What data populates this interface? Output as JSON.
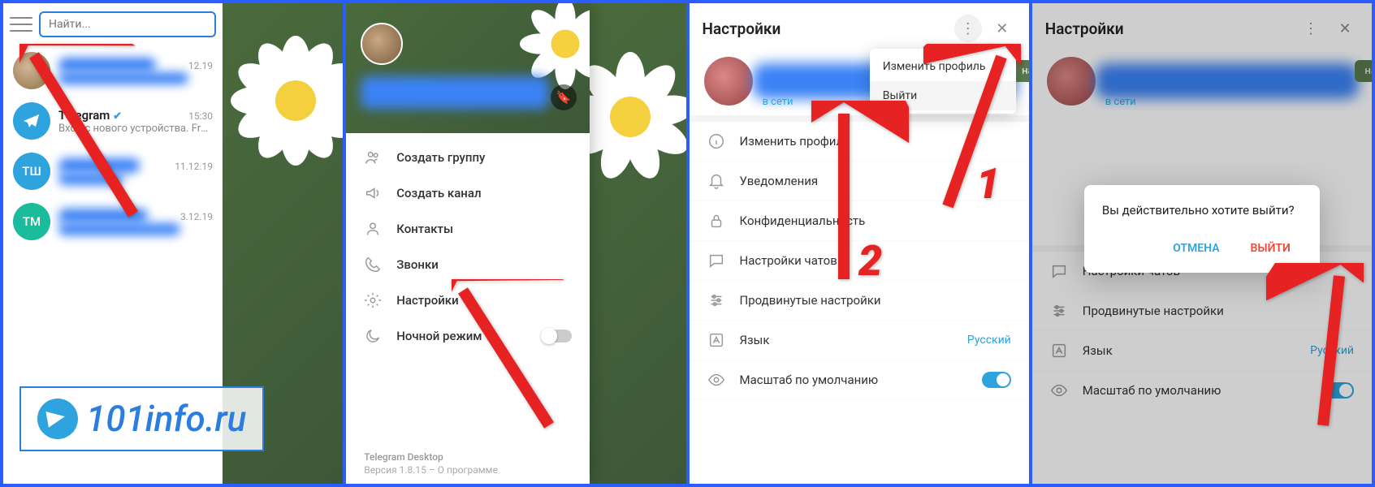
{
  "panel1": {
    "search_placeholder": "Найти...",
    "chats": [
      {
        "name": "",
        "date": "12.19",
        "preview": ""
      },
      {
        "name": "Telegram",
        "date": "15:30",
        "preview": "Вход с нового устройства. From...",
        "verified": true
      },
      {
        "initials": "ТШ",
        "name": "",
        "date": "11.12.19",
        "preview": ""
      },
      {
        "initials": "ТМ",
        "name": "",
        "date": "3.12.19",
        "preview": ""
      }
    ]
  },
  "watermark": "101info.ru",
  "drawer": {
    "items": [
      {
        "icon": "group",
        "label": "Создать группу"
      },
      {
        "icon": "channel",
        "label": "Создать канал"
      },
      {
        "icon": "contacts",
        "label": "Контакты"
      },
      {
        "icon": "calls",
        "label": "Звонки"
      },
      {
        "icon": "settings",
        "label": "Настройки"
      },
      {
        "icon": "night",
        "label": "Ночной режим"
      }
    ],
    "footer_title": "Telegram Desktop",
    "footer_sub": "Версия 1.8.15 – О программе"
  },
  "settings": {
    "title": "Настройки",
    "status": "в сети",
    "write": "написать",
    "items": [
      {
        "icon": "info",
        "label": "Изменить профиль"
      },
      {
        "icon": "bell",
        "label": "Уведомления"
      },
      {
        "icon": "lock",
        "label": "Конфиденциальность"
      },
      {
        "icon": "chat",
        "label": "Настройки чатов"
      },
      {
        "icon": "sliders",
        "label": "Продвинутые настройки"
      },
      {
        "icon": "lang",
        "label": "Язык",
        "value": "Русский"
      },
      {
        "icon": "eye",
        "label": "Масштаб по умолчанию",
        "toggle": true
      }
    ],
    "items_short": [
      {
        "icon": "chat",
        "label": "Настройки чатов"
      },
      {
        "icon": "sliders",
        "label": "Продвинутые настройки"
      },
      {
        "icon": "lang",
        "label": "Язык",
        "value": "Русский"
      },
      {
        "icon": "eye",
        "label": "Масштаб по умолчанию",
        "toggle": true
      }
    ]
  },
  "dropdown": {
    "edit": "Изменить профиль",
    "logout": "Выйти"
  },
  "dialog": {
    "text": "Вы действительно хотите выйти?",
    "cancel": "ОТМЕНА",
    "logout": "ВЫЙТИ"
  },
  "arrows": {
    "num1": "1",
    "num2": "2"
  }
}
